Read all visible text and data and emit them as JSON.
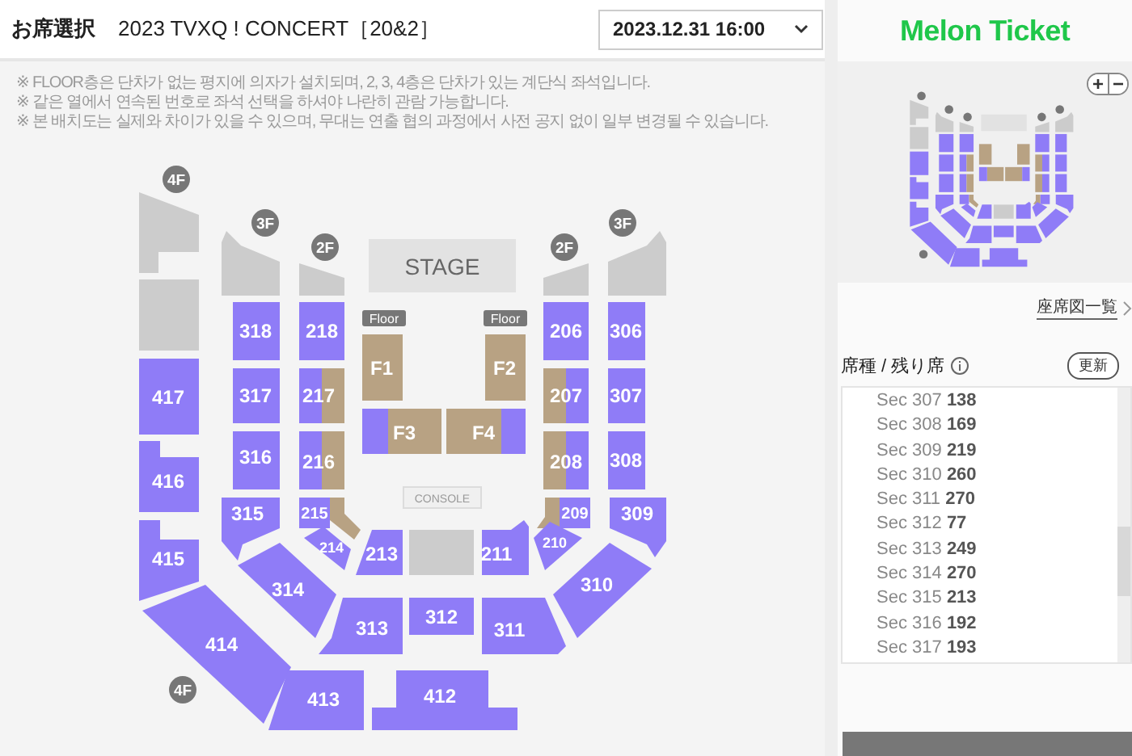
{
  "header": {
    "title": "お席選択",
    "event": "2023 TVXQ ! CONCERT［20&2］",
    "date_select": {
      "value": "2023.12.31 16:00"
    }
  },
  "notes": [
    "※ FLOOR층은 단차가 없는 평지에 의자가 설치되며, 2, 3, 4층은 단차가 있는 계단식 좌석입니다.",
    "※ 같은 열에서 연속된 번호로 좌석 선택을 하셔야 나란히 관람 가능합니다.",
    "※ 본 배치도는 실제와 차이가 있을 수 있으며, 무대는 연출 협의 과정에서 사전 공지 없이 일부 변경될 수 있습니다."
  ],
  "seat_map": {
    "level_badges": [
      "4F",
      "3F",
      "2F",
      "2F",
      "3F",
      "4F"
    ],
    "stage": "STAGE",
    "floor_tags": [
      "Floor",
      "Floor"
    ],
    "console": "CONSOLE",
    "sections": [
      {
        "label": "318",
        "color": "#8f7cf7"
      },
      {
        "label": "218",
        "color": "#8f7cf7"
      },
      {
        "label": "F1",
        "color": "#b8a283"
      },
      {
        "label": "F2",
        "color": "#b8a283"
      },
      {
        "label": "206",
        "color": "#8f7cf7"
      },
      {
        "label": "306",
        "color": "#8f7cf7"
      },
      {
        "label": "417",
        "color": "#8f7cf7"
      },
      {
        "label": "317",
        "color": "#8f7cf7"
      },
      {
        "label": "217",
        "color": "#8f7cf7",
        "accent": {
          "color": "#b8a283"
        }
      },
      {
        "label": "207",
        "color": "#8f7cf7",
        "accent": {
          "color": "#b8a283"
        }
      },
      {
        "label": "307",
        "color": "#8f7cf7"
      },
      {
        "label": "F3",
        "color": "#b8a283",
        "accent": {
          "color": "#8f7cf7"
        }
      },
      {
        "label": "F4",
        "color": "#b8a283",
        "accent": {
          "color": "#8f7cf7"
        }
      },
      {
        "label": "316",
        "color": "#8f7cf7"
      },
      {
        "label": "216",
        "color": "#8f7cf7",
        "accent": {
          "color": "#b8a283"
        }
      },
      {
        "label": "208",
        "color": "#8f7cf7",
        "accent": {
          "color": "#b8a283"
        }
      },
      {
        "label": "308",
        "color": "#8f7cf7"
      },
      {
        "label": "416",
        "color": "#8f7cf7"
      },
      {
        "label": "315",
        "color": "#8f7cf7"
      },
      {
        "label": "215",
        "color": "#8f7cf7",
        "accent": {
          "color": "#b8a283"
        }
      },
      {
        "label": "209",
        "color": "#8f7cf7",
        "accent": {
          "color": "#b8a283"
        }
      },
      {
        "label": "309",
        "color": "#8f7cf7"
      },
      {
        "label": "214",
        "color": "#8f7cf7"
      },
      {
        "label": "213",
        "color": "#8f7cf7"
      },
      {
        "label": "211",
        "color": "#8f7cf7"
      },
      {
        "label": "210",
        "color": "#8f7cf7"
      },
      {
        "label": "415",
        "color": "#8f7cf7"
      },
      {
        "label": "314",
        "color": "#8f7cf7"
      },
      {
        "label": "310",
        "color": "#8f7cf7"
      },
      {
        "label": "313",
        "color": "#8f7cf7"
      },
      {
        "label": "312",
        "color": "#8f7cf7"
      },
      {
        "label": "311",
        "color": "#8f7cf7"
      },
      {
        "label": "414",
        "color": "#8f7cf7"
      },
      {
        "label": "413",
        "color": "#8f7cf7"
      },
      {
        "label": "412",
        "color": "#8f7cf7"
      }
    ]
  },
  "sidebar": {
    "logo": "Melon Ticket",
    "zoom_buttons": [
      "+",
      "−"
    ],
    "map_list_link": "座席図一覧",
    "remaining_title": "席種 / 残り席",
    "refresh_button": "更新",
    "remaining": [
      {
        "section": "Sec 307",
        "count": "138"
      },
      {
        "section": "Sec 308",
        "count": "169"
      },
      {
        "section": "Sec 309",
        "count": "219"
      },
      {
        "section": "Sec 310",
        "count": "260"
      },
      {
        "section": "Sec 311",
        "count": "270"
      },
      {
        "section": "Sec 312",
        "count": "77"
      },
      {
        "section": "Sec 313",
        "count": "249"
      },
      {
        "section": "Sec 314",
        "count": "270"
      },
      {
        "section": "Sec 315",
        "count": "213"
      },
      {
        "section": "Sec 316",
        "count": "192"
      },
      {
        "section": "Sec 317",
        "count": "193"
      }
    ]
  }
}
